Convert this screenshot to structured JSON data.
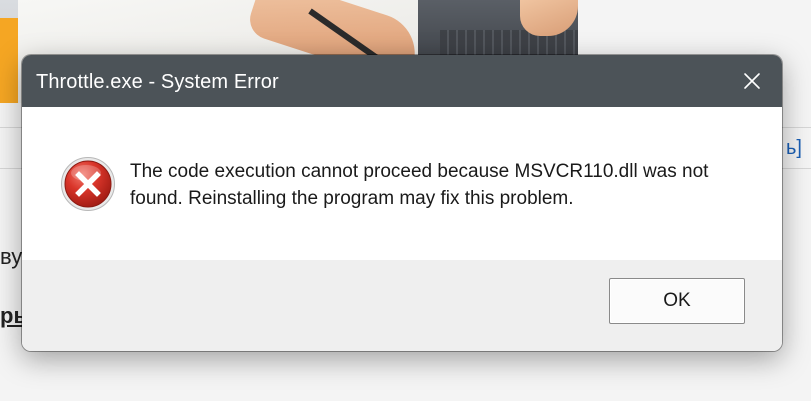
{
  "dialog": {
    "title": "Throttle.exe - System Error",
    "message": "The code execution cannot proceed because MSVCR110.dll was not found. Reinstalling the program may fix this problem.",
    "ok_label": "OK",
    "icon": "error-icon",
    "titlebar_color": "#4c5358",
    "error_icon_color": "#c42b1c"
  },
  "background_page": {
    "right_fragment": "ь]",
    "left_fragment_1": "ву",
    "left_fragment_2": "рь"
  }
}
